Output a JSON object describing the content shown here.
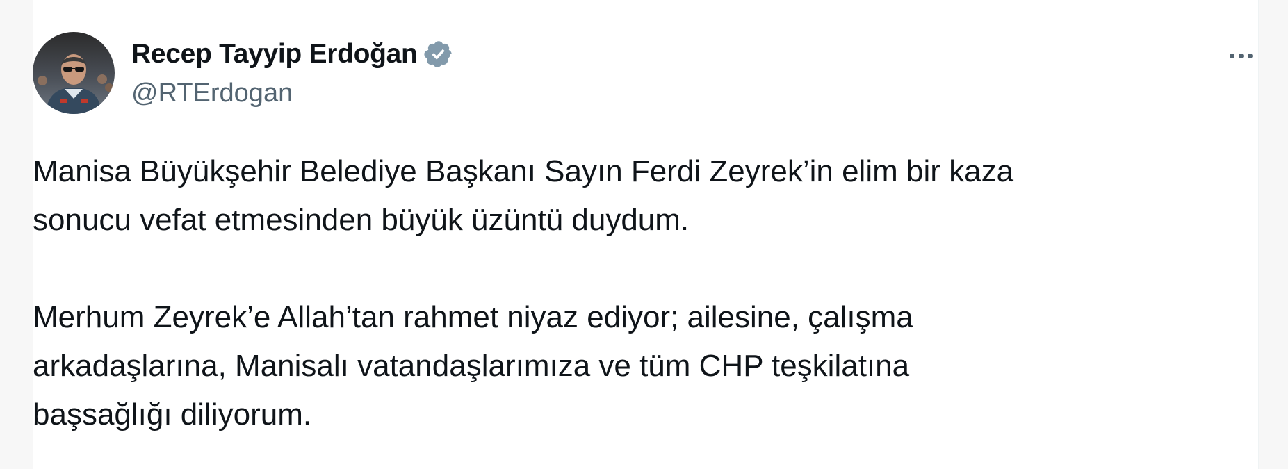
{
  "author": {
    "display_name": "Recep Tayyip Erdoğan",
    "handle": "@RTErdogan",
    "verified": true,
    "verified_badge_color": "#829aab",
    "avatar_icon": "profile-photo"
  },
  "menu": {
    "icon": "more-horizontal-icon"
  },
  "tweet": {
    "paragraphs": [
      {
        "line1": "Manisa Büyükşehir Belediye Başkanı Sayın Ferdi Zeyrek’in elim bir kaza",
        "line2": "sonucu vefat etmesinden büyük üzüntü duydum."
      },
      {
        "line1": "Merhum Zeyrek’e Allah’tan rahmet niyaz ediyor; ailesine, çalışma",
        "line2": "arkadaşlarına, Manisalı vatandaşlarımıza ve tüm CHP teşkilatına",
        "line3": "başsağlığı diliyorum."
      }
    ]
  },
  "colors": {
    "text_primary": "#0f1419",
    "text_secondary": "#536471",
    "background": "#ffffff"
  }
}
